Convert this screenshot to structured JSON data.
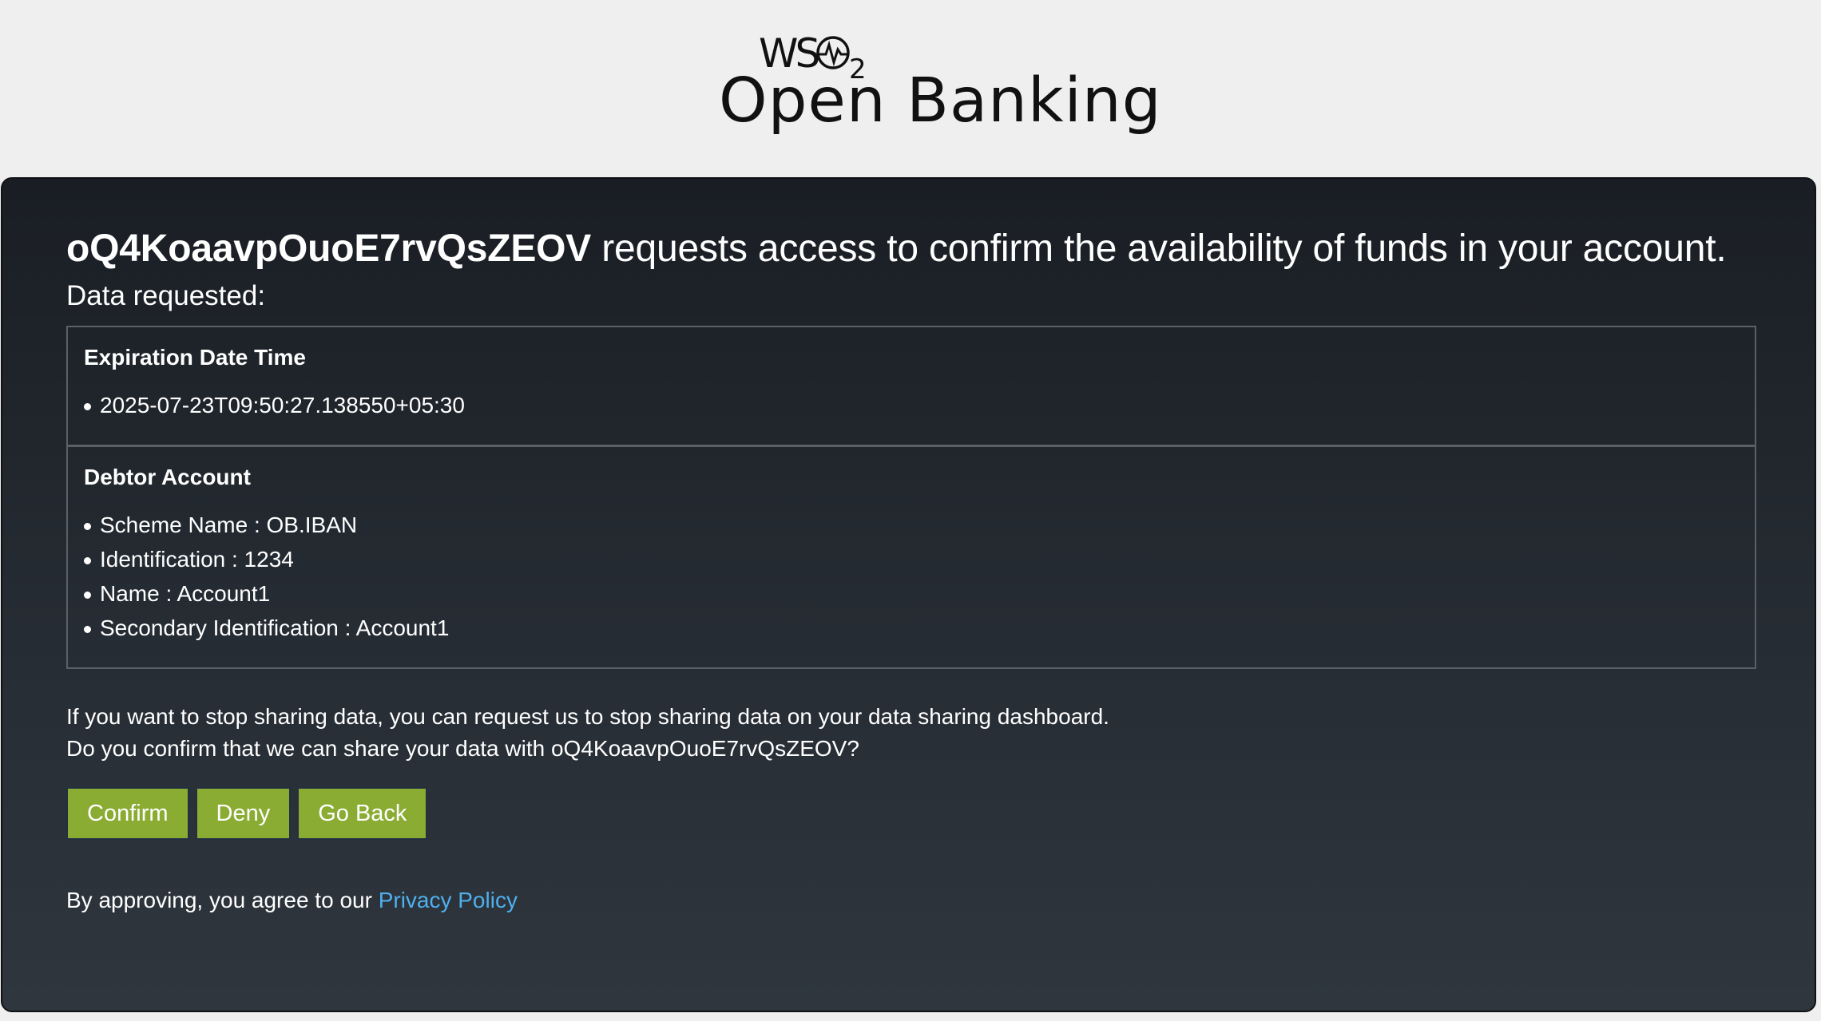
{
  "brand": {
    "logo_mark": "WSO2",
    "product_name": "Open Banking"
  },
  "consent": {
    "app_id": "oQ4KoaavpOuoE7rvQsZEOV",
    "headline_rest": " requests access to confirm the availability of funds in your account.",
    "data_requested_label": "Data requested:",
    "sections": [
      {
        "title": "Expiration Date Time",
        "items": [
          "2025-07-23T09:50:27.138550+05:30"
        ]
      },
      {
        "title": "Debtor Account",
        "items": [
          "Scheme Name : OB.IBAN",
          "Identification : 1234",
          "Name : Account1",
          "Secondary Identification : Account1"
        ]
      }
    ],
    "stop_sharing_text": "If you want to stop sharing data, you can request us to stop sharing data on your data sharing dashboard.",
    "confirm_question": "Do you confirm that we can share your data with oQ4KoaavpOuoE7rvQsZEOV?"
  },
  "buttons": {
    "confirm": "Confirm",
    "deny": "Deny",
    "go_back": "Go Back"
  },
  "policy": {
    "prefix": "By approving, you agree to our ",
    "link_text": "Privacy Policy"
  },
  "colors": {
    "button_bg": "#8aac33",
    "link": "#4fb0ee",
    "page_bg": "#efefef",
    "card_bg_top": "#1a1e24",
    "card_bg_bottom": "#2f363e"
  }
}
